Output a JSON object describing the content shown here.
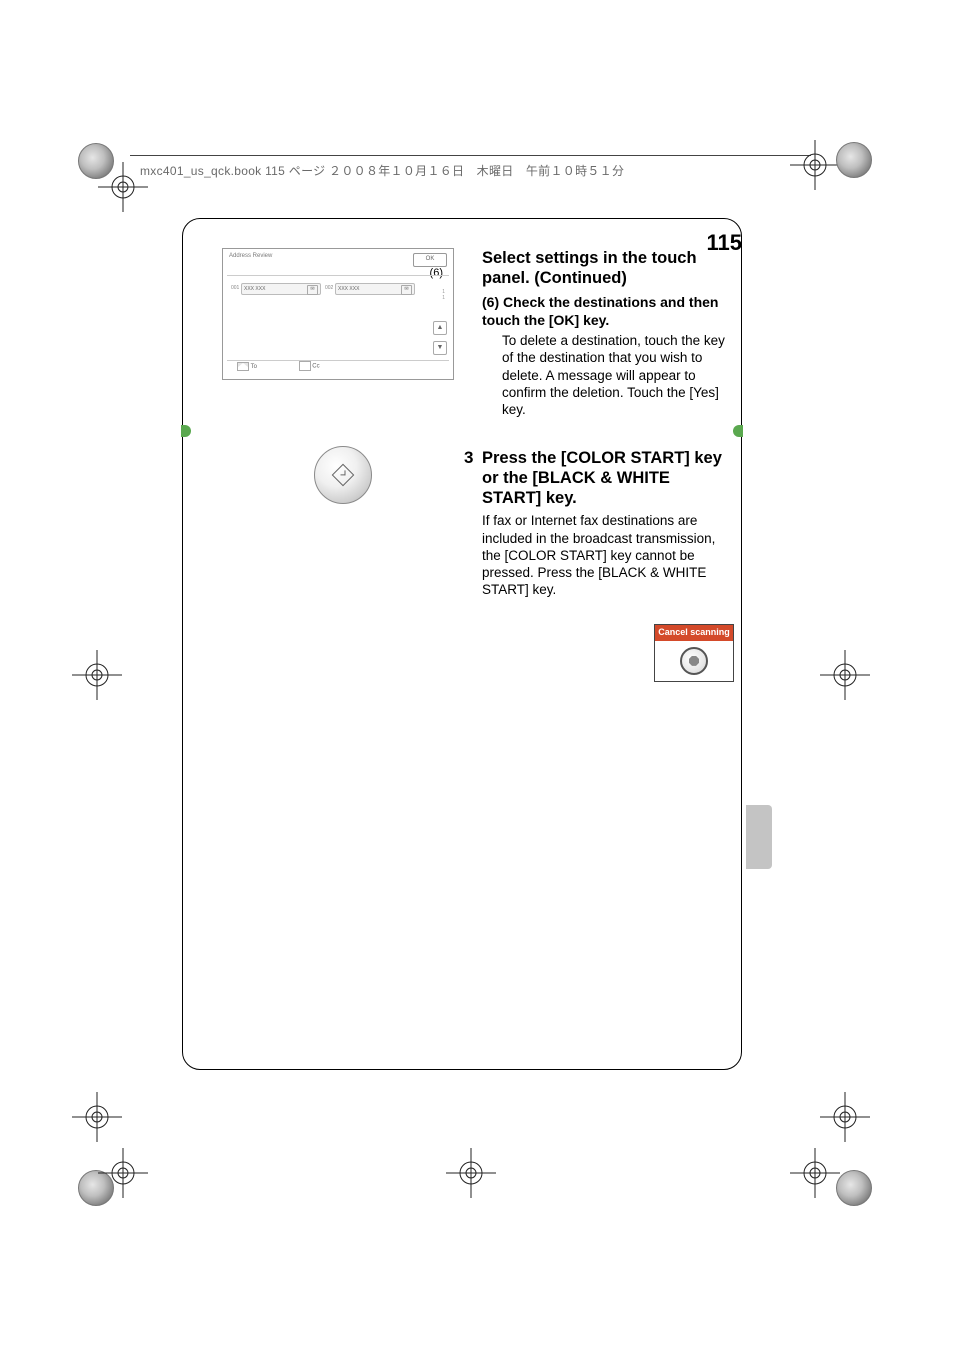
{
  "print_header": "mxc401_us_qck.book  115 ページ  ２００８年１０月１６日　木曜日　午前１０時５１分",
  "page_number": "115",
  "panel": {
    "title": "Address Review",
    "ok_label": "OK",
    "callout_label": "(6)",
    "dest1_num": "001",
    "dest1_label": "XXX XXX",
    "dest2_num": "002",
    "dest2_label": "XXX XXX",
    "pager_top": "1",
    "pager_bottom": "1",
    "bottom_to": "To",
    "bottom_cc": "Cc"
  },
  "section2": {
    "heading": "Select settings in the touch panel. (Continued)",
    "sub": "(6) Check the destinations and then touch the [OK] key.",
    "body": "To delete a destination, touch the key of the destination that you wish to delete. A message will appear to confirm the deletion. Touch the [Yes] key."
  },
  "section3": {
    "num": "3",
    "heading": "Press the [COLOR START] key or the [BLACK & WHITE START] key.",
    "body": "If fax or Internet fax destinations are included in the broadcast transmission, the [COLOR START] key cannot be pressed. Press the [BLACK & WHITE START] key."
  },
  "cancel_label": "Cancel scanning"
}
